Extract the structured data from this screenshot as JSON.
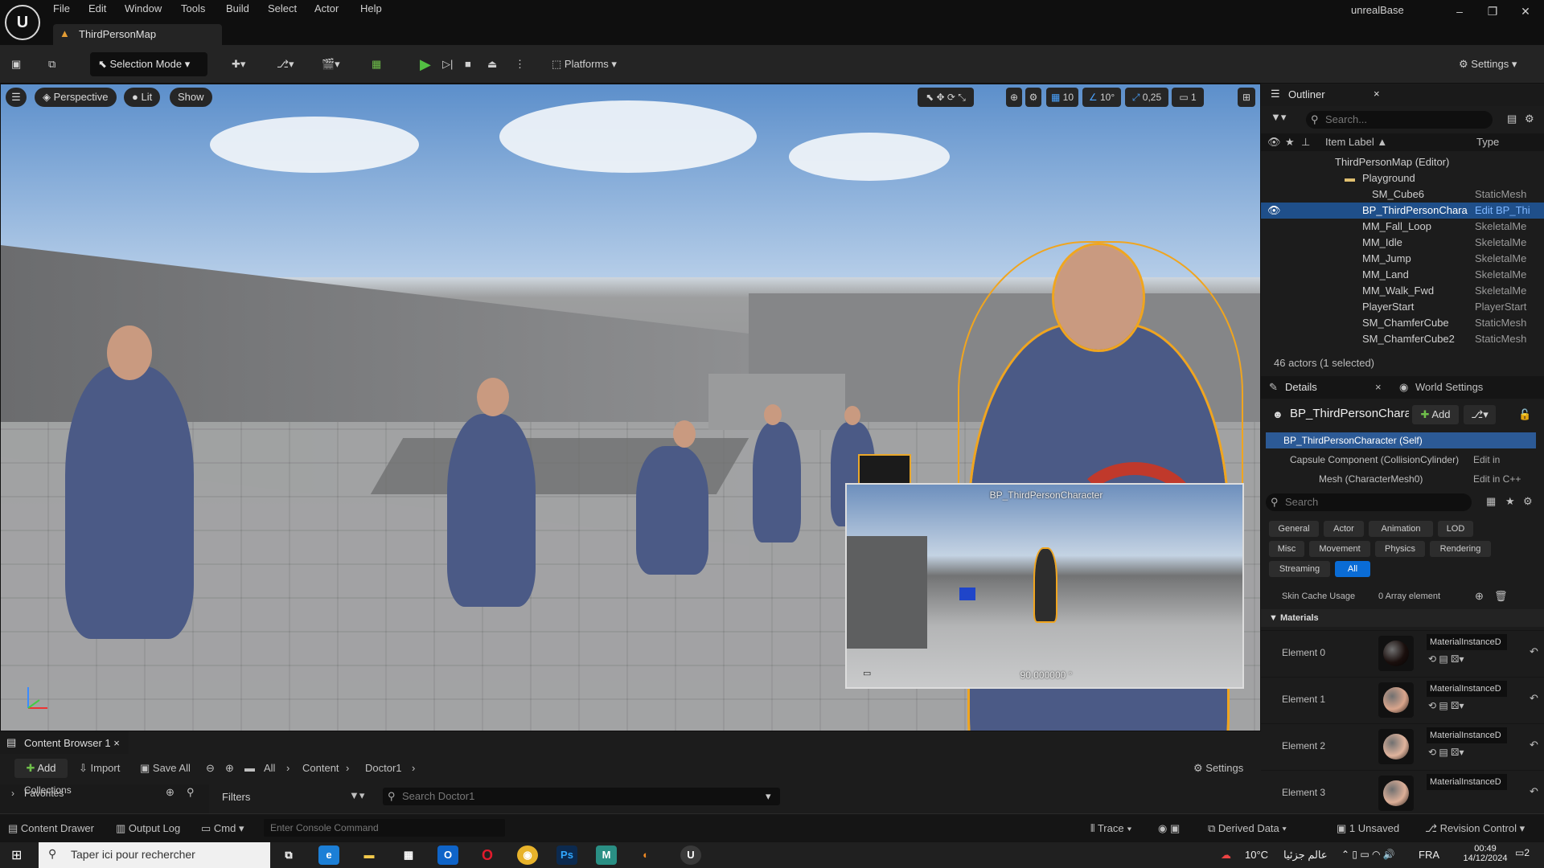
{
  "app": {
    "name": "unrealBase",
    "logo": "U"
  },
  "menu": [
    "File",
    "Edit",
    "Window",
    "Tools",
    "Build",
    "Select",
    "Actor",
    "Help"
  ],
  "map_tab": "ThirdPersonMap",
  "toolbar": {
    "selection_mode": "Selection Mode",
    "platforms": "Platforms",
    "settings": "Settings"
  },
  "viewport": {
    "perspective": "Perspective",
    "lit": "Lit",
    "show": "Show",
    "grid_snap": "10",
    "rot_snap": "10°",
    "scale_snap": "0,25",
    "camera_speed": "1",
    "preview_title": "BP_ThirdPersonCharacter",
    "preview_value": "90.000000 °"
  },
  "outliner": {
    "title": "Outliner",
    "search_placeholder": "Search...",
    "col_label": "Item Label ▲",
    "col_type": "Type",
    "rows": [
      {
        "label": "ThirdPersonMap (Editor)",
        "type": ""
      },
      {
        "label": "Playground",
        "type": ""
      },
      {
        "label": "SM_Cube6",
        "type": "StaticMesh"
      },
      {
        "label": "BP_ThirdPersonChara",
        "type": "Edit BP_Thi"
      },
      {
        "label": "MM_Fall_Loop",
        "type": "SkeletalMe"
      },
      {
        "label": "MM_Idle",
        "type": "SkeletalMe"
      },
      {
        "label": "MM_Jump",
        "type": "SkeletalMe"
      },
      {
        "label": "MM_Land",
        "type": "SkeletalMe"
      },
      {
        "label": "MM_Walk_Fwd",
        "type": "SkeletalMe"
      },
      {
        "label": "PlayerStart",
        "type": "PlayerStart"
      },
      {
        "label": "SM_ChamferCube",
        "type": "StaticMesh"
      },
      {
        "label": "SM_ChamferCube2",
        "type": "StaticMesh"
      }
    ],
    "footer": "46 actors (1 selected)"
  },
  "details": {
    "tab_details": "Details",
    "tab_world": "World Settings",
    "actor_name": "BP_ThirdPersonChara",
    "add": "Add",
    "components": [
      {
        "label": "BP_ThirdPersonCharacter (Self)",
        "extra": ""
      },
      {
        "label": "Capsule Component (CollisionCylinder)",
        "extra": "Edit in"
      },
      {
        "label": "Mesh (CharacterMesh0)",
        "extra": "Edit in C++"
      }
    ],
    "search_placeholder": "Search",
    "categories": [
      "General",
      "Actor",
      "Animation",
      "LOD",
      "Misc",
      "Movement",
      "Physics",
      "Rendering",
      "Streaming",
      "All"
    ],
    "skin_cache_label": "Skin Cache Usage",
    "skin_cache_value": "0 Array element",
    "materials_header": "Materials",
    "elements": [
      {
        "name": "Element 0",
        "material": "MaterialInstanceD",
        "color": "#1a0f0d"
      },
      {
        "name": "Element 1",
        "material": "MaterialInstanceD",
        "color": "#d9a58c"
      },
      {
        "name": "Element 2",
        "material": "MaterialInstanceD",
        "color": "#e0b49d"
      },
      {
        "name": "Element 3",
        "material": "MaterialInstanceD",
        "color": "#dcaf98"
      }
    ]
  },
  "content_browser": {
    "tab": "Content Browser 1",
    "add": "Add",
    "import": "Import",
    "save_all": "Save All",
    "path": [
      "All",
      "Content",
      "Doctor1"
    ],
    "settings": "Settings",
    "favorites": "Favorites",
    "collections": "Collections",
    "filters": "Filters",
    "search_placeholder": "Search Doctor1"
  },
  "statusbar": {
    "content_drawer": "Content Drawer",
    "output_log": "Output Log",
    "cmd": "Cmd",
    "console_placeholder": "Enter Console Command",
    "trace": "Trace",
    "derived_data": "Derived Data",
    "unsaved": "1 Unsaved",
    "revision_control": "Revision Control"
  },
  "taskbar": {
    "search_placeholder": "Taper ici pour rechercher",
    "temperature": "10°C",
    "weather_text": "عالم جزئيا",
    "lang": "FRA",
    "time": "00:49",
    "date": "14/12/2024",
    "notifications": "2"
  }
}
